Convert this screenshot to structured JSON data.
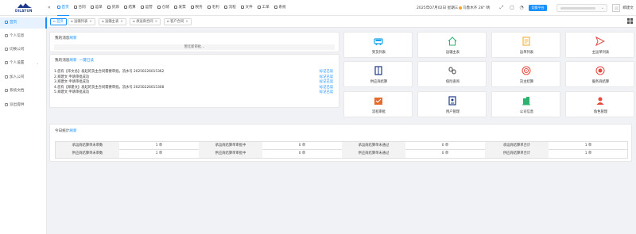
{
  "brand": {
    "logo_text": "DILAYUN"
  },
  "topnav": [
    {
      "label": "首页",
      "active": true
    },
    {
      "label": "合同"
    },
    {
      "label": "运单"
    },
    {
      "label": "货源"
    },
    {
      "label": "结算"
    },
    {
      "label": "运营"
    },
    {
      "label": "仓储"
    },
    {
      "label": "发票"
    },
    {
      "label": "税务"
    },
    {
      "label": "毛利"
    },
    {
      "label": "流程"
    },
    {
      "label": "文件"
    },
    {
      "label": "工单"
    },
    {
      "label": "系统"
    }
  ],
  "header": {
    "datetime": "2025年07月02日 星期三",
    "weather": "乌鲁木齐 28° 晴",
    "switch_label": "切换平台",
    "org_name": "",
    "username": "郑建文"
  },
  "sidebar": [
    {
      "label": "首页",
      "active": true
    },
    {
      "label": "个人信息"
    },
    {
      "label": "切换公司"
    },
    {
      "label": "个人设置",
      "caret": "⌄"
    },
    {
      "label": "加入公司"
    },
    {
      "label": "系统文档"
    },
    {
      "label": "派出提供"
    }
  ],
  "tabs": [
    {
      "label": "首页",
      "active": true
    },
    {
      "label": "运输列表",
      "close": "×"
    },
    {
      "label": "运输主表",
      "close": "×"
    },
    {
      "label": "承运商合同",
      "close": "×"
    },
    {
      "label": "客户合同",
      "close": "×"
    }
  ],
  "messages": {
    "title": "我的消息",
    "refresh": "刷新",
    "empty": "暂无新审批..."
  },
  "news": {
    "title": "我的消息",
    "refresh": "刷新",
    "mark_all": "一键已读",
    "mark_label": "标记已读",
    "items": [
      "1.您有【华文总】发起的货主合同需要审批。流水号 20250226015362",
      "2.郑建文 申请审批成功",
      "3.郑建文 申请审批成功",
      "4.您有【郑建文】发起的货主合同需要审批。流水号 20250226015308",
      "5.郑建文 申请审批成功"
    ]
  },
  "shortcuts": [
    {
      "label": "到货列表",
      "icon": "truck-icon",
      "color": "#1aa3e8"
    },
    {
      "label": "运输主表",
      "icon": "home-icon",
      "color": "#2db36f"
    },
    {
      "label": "运单列表",
      "icon": "document-icon",
      "color": "#f5a623"
    },
    {
      "label": "主运单列表",
      "icon": "send-icon",
      "color": "#e8473b"
    },
    {
      "label": "供应商结算",
      "icon": "book-icon",
      "color": "#1d3a8a"
    },
    {
      "label": "保险查询",
      "icon": "link-icon",
      "color": "#444444"
    },
    {
      "label": "货主结算",
      "icon": "target-icon",
      "color": "#e8473b"
    },
    {
      "label": "服务商结算",
      "icon": "record-icon",
      "color": "#e8473b"
    },
    {
      "label": "流程审批",
      "icon": "approval-icon",
      "color": "#e86a2b"
    },
    {
      "label": "用户管理",
      "icon": "user-card-icon",
      "color": "#1d3a8a"
    },
    {
      "label": "公司信息",
      "icon": "building-icon",
      "color": "#2db36f"
    },
    {
      "label": "角色管理",
      "icon": "role-icon",
      "color": "#e8473b"
    }
  ],
  "stats": {
    "title": "今日统计",
    "refresh": "刷新",
    "rows": [
      [
        {
          "label": "承运商结算单未审数",
          "value": "1 单"
        },
        {
          "label": "承运商结算单审批中",
          "value": "0 单"
        },
        {
          "label": "承运商结算单未通过",
          "value": "0 单"
        },
        {
          "label": "承运商结算单合计",
          "value": "1 单"
        }
      ],
      [
        {
          "label": "供应商结算单未审数",
          "value": "1 单"
        },
        {
          "label": "供应商结算单审批中",
          "value": "0 单"
        },
        {
          "label": "供应商结算单未通过",
          "value": "0 单"
        },
        {
          "label": "供应商结算单合计",
          "value": "1 单"
        }
      ]
    ]
  },
  "colors": {
    "accent": "#1890ff",
    "active_bg": "#e6f2ff"
  }
}
